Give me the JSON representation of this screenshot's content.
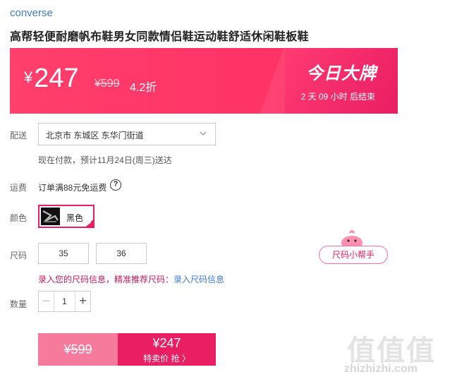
{
  "product": {
    "brand": "converse",
    "title": "高帮轻便耐磨帆布鞋男女同款情侣鞋运动鞋舒适休闲鞋板鞋"
  },
  "price_banner": {
    "currency": "¥",
    "current_price": "247",
    "original_price": "¥599",
    "discount": "4.2折",
    "promo_title": "今日大牌",
    "countdown": "2 天 09 小时 后结束"
  },
  "delivery": {
    "label": "配送",
    "address": "北京市 东城区 东华门街道",
    "note": "现在付款，预计11月24日(周三)送达"
  },
  "shipping": {
    "label": "运费",
    "text": "订单满88元免运费",
    "help": "?"
  },
  "color": {
    "label": "颜色",
    "selected": "黑色"
  },
  "size": {
    "label": "尺码",
    "options": [
      "35",
      "36"
    ],
    "helper": "尺码小帮手",
    "tip_prefix": "录入您的尺码信息，精准推荐尺码：",
    "tip_link": "录入尺码信息"
  },
  "quantity": {
    "label": "数量",
    "value": "1",
    "minus": "−",
    "plus": "+"
  },
  "buy": {
    "original_price": "¥599",
    "deal_price": "¥247",
    "deal_label": "特卖价 抢 〉"
  },
  "watermark": {
    "glyphs": "值值值",
    "url": "zhizhizhi.com"
  },
  "colors": {
    "accent": "#e91e63",
    "banner": "#ff3f6c",
    "link": "#3b7bd4"
  }
}
